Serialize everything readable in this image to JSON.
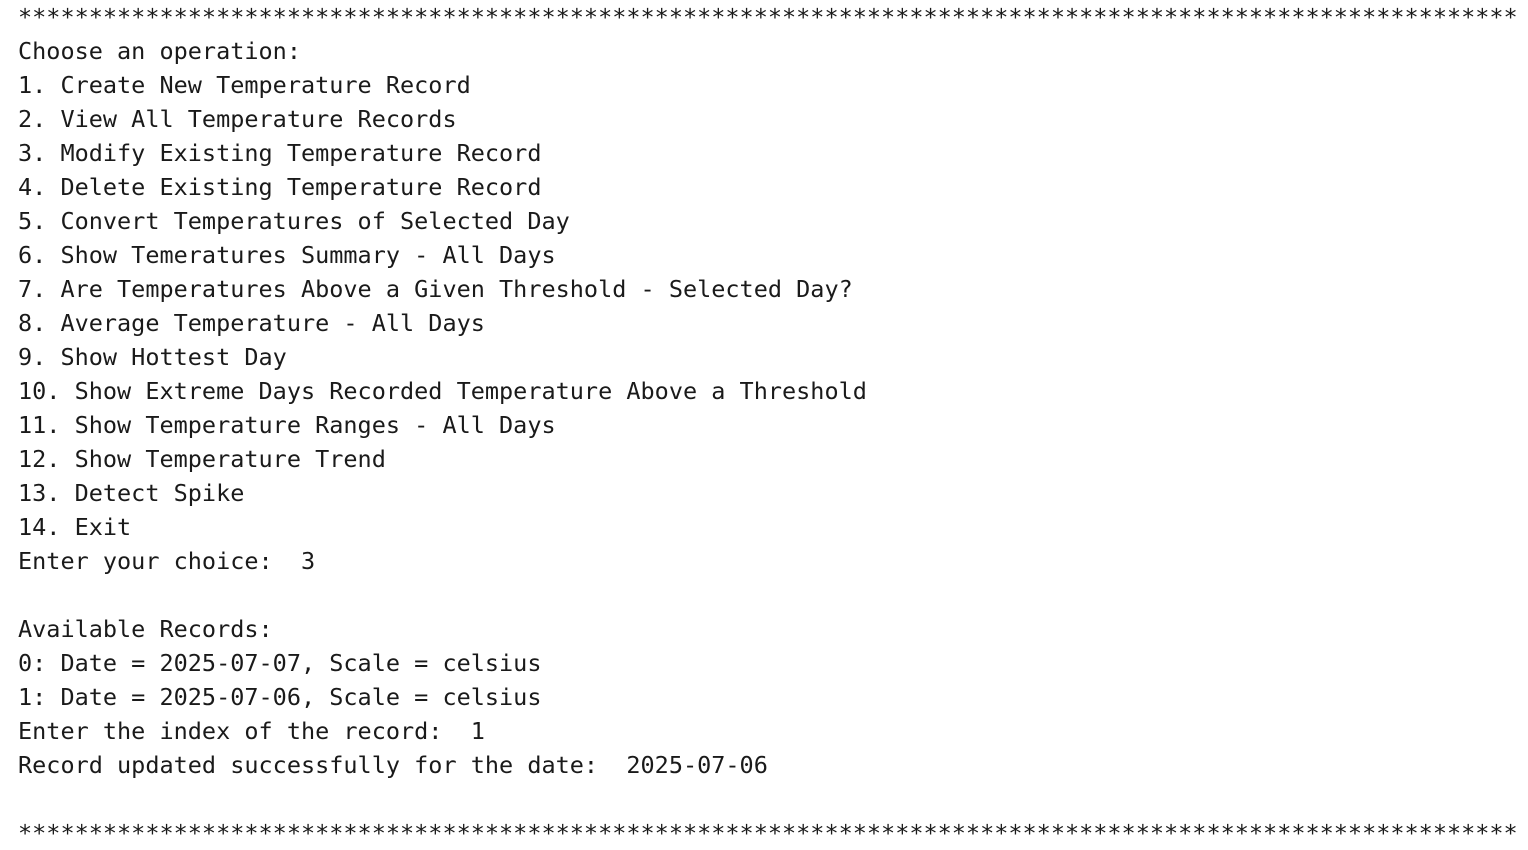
{
  "separator": "***********************************************************************************************************************",
  "menu": {
    "prompt": "Choose an operation:",
    "items": [
      "1. Create New Temperature Record",
      "2. View All Temperature Records",
      "3. Modify Existing Temperature Record",
      "4. Delete Existing Temperature Record",
      "5. Convert Temperatures of Selected Day",
      "6. Show Temeratures Summary - All Days",
      "7. Are Temperatures Above a Given Threshold - Selected Day?",
      "8. Average Temperature - All Days",
      "9. Show Hottest Day",
      "10. Show Extreme Days Recorded Temperature Above a Threshold",
      "11. Show Temperature Ranges - All Days",
      "12. Show Temperature Trend",
      "13. Detect Spike",
      "14. Exit"
    ],
    "choice_line": "Enter your choice:  3"
  },
  "records": {
    "heading": "Available Records:",
    "items": [
      "0: Date = 2025-07-07, Scale = celsius",
      "1: Date = 2025-07-06, Scale = celsius"
    ],
    "index_line": "Enter the index of the record:  1",
    "result_line": "Record updated successfully for the date:  2025-07-06"
  }
}
